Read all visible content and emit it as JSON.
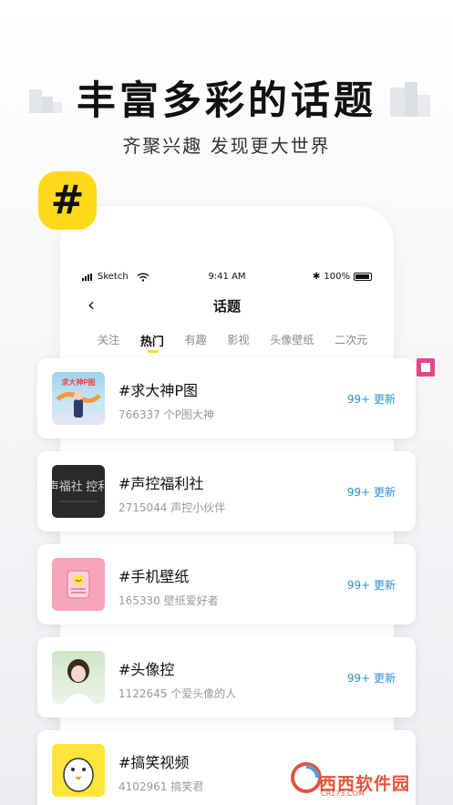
{
  "hero": {
    "headline": "丰富多彩的话题",
    "subline": "齐聚兴趣 发现更大世界",
    "badge": "#"
  },
  "status_bar": {
    "carrier": "Sketch",
    "time": "9:41 AM",
    "battery": "100%"
  },
  "nav": {
    "back": "‹",
    "title": "话题"
  },
  "tabs": [
    "关注",
    "热门",
    "有趣",
    "影视",
    "头像壁纸",
    "二次元"
  ],
  "active_tab": "热门",
  "topics": [
    {
      "title": "#求大神P图",
      "sub": "766337 个P图大神",
      "update": "99+ 更新",
      "thumb_text": "求大神P图"
    },
    {
      "title": "#声控福利社",
      "sub": "2715044 声控小伙伴",
      "update": "99+ 更新",
      "thumb_text": "声福社 控利"
    },
    {
      "title": "#手机壁纸",
      "sub": "165330 壁纸爱好者",
      "update": "99+ 更新",
      "thumb_text": ""
    },
    {
      "title": "#头像控",
      "sub": "1122645 个爱头像的人",
      "update": "99+ 更新",
      "thumb_text": ""
    },
    {
      "title": "#搞笑视频",
      "sub": "4102961 搞笑君",
      "update": "",
      "thumb_text": ""
    }
  ],
  "watermark": {
    "name": "西西软件园",
    "site": "CR173.COM"
  },
  "colors": {
    "accent_yellow": "#ffd91a",
    "update_blue": "#2a8fd8",
    "pink_marker": "#e8468a"
  }
}
